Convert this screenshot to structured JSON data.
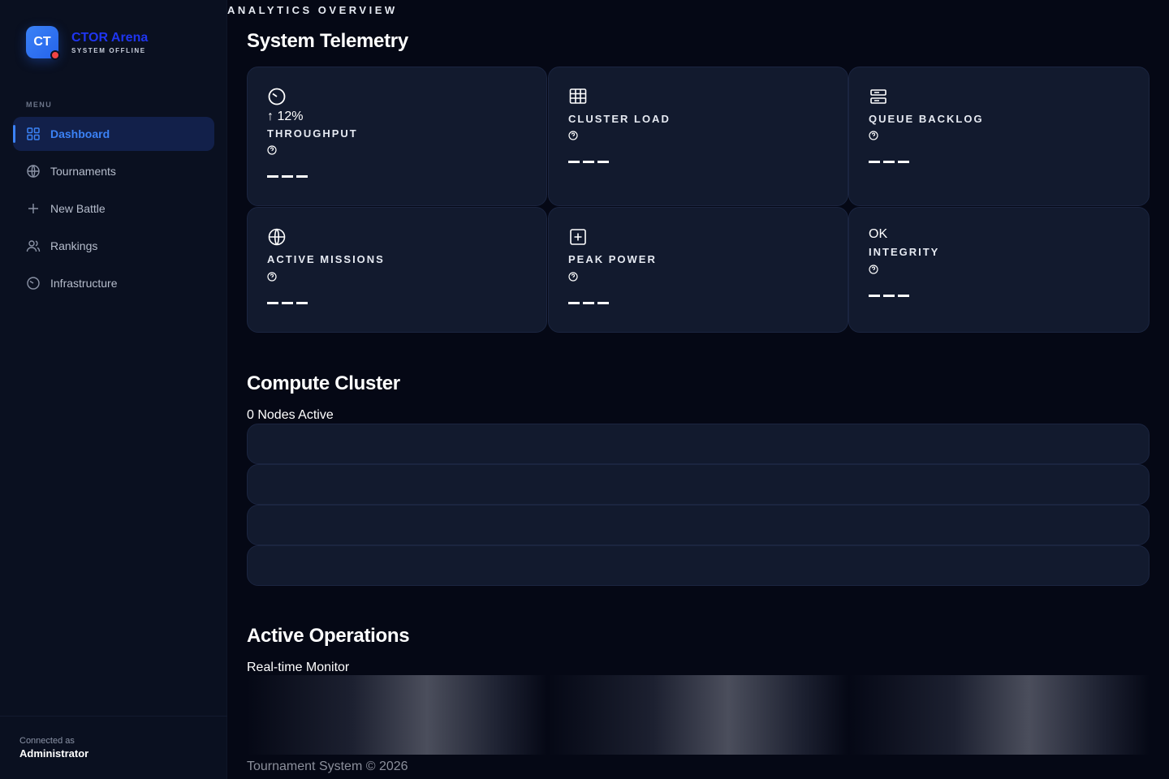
{
  "brand": {
    "logo_text": "CT",
    "name": "CTOR Arena",
    "status": "SYSTEM OFFLINE",
    "accent": "#3b82f6",
    "status_dot_color": "#ef4444"
  },
  "sidebar": {
    "menu_label": "MENU",
    "items": [
      {
        "label": "Dashboard",
        "icon": "grid-icon",
        "active": true
      },
      {
        "label": "Tournaments",
        "icon": "globe-icon",
        "active": false
      },
      {
        "label": "New Battle",
        "icon": "plus-icon",
        "active": false
      },
      {
        "label": "Rankings",
        "icon": "users-icon",
        "active": false
      },
      {
        "label": "Infrastructure",
        "icon": "gauge-icon",
        "active": false
      }
    ],
    "footer": {
      "caption": "Connected as",
      "user": "Administrator"
    }
  },
  "header": {
    "eyebrow": "ANALYTICS OVERVIEW"
  },
  "telemetry": {
    "title": "System Telemetry",
    "cards": [
      {
        "label": "THROUGHPUT",
        "delta": "↑ 12%",
        "icon": "gauge-icon"
      },
      {
        "label": "CLUSTER LOAD",
        "icon": "table-icon"
      },
      {
        "label": "QUEUE BACKLOG",
        "icon": "server-icon"
      },
      {
        "label": "ACTIVE MISSIONS",
        "icon": "globe-icon"
      },
      {
        "label": "PEAK POWER",
        "icon": "plus-square-icon"
      },
      {
        "label": "INTEGRITY",
        "status": "OK"
      }
    ]
  },
  "cluster": {
    "title": "Compute Cluster",
    "subtitle": "0 Nodes Active"
  },
  "operations": {
    "title": "Active Operations",
    "subtitle": "Real-time Monitor"
  },
  "footer": {
    "copyright": "Tournament System © 2026"
  }
}
